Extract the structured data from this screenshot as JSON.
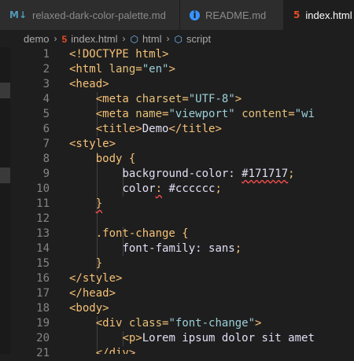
{
  "tabs": [
    {
      "label": "relaxed-dark-color-palette.md",
      "icon": "markdown-icon",
      "icon_text": "M↓",
      "active": false
    },
    {
      "label": "README.md",
      "icon": "info-icon",
      "icon_text": "i",
      "active": false
    },
    {
      "label": "index.html",
      "icon": "html5-icon",
      "icon_text": "5",
      "active": true
    }
  ],
  "breadcrumb": {
    "items": [
      {
        "label": "demo",
        "icon": ""
      },
      {
        "label": "index.html",
        "icon": "html5-icon",
        "icon_text": "5"
      },
      {
        "label": "html",
        "icon": "cube-icon",
        "icon_text": "⬡"
      },
      {
        "label": "script",
        "icon": "cube-icon",
        "icon_text": "⬡"
      }
    ],
    "separator": "›"
  },
  "editor": {
    "line_numbers": [
      "1",
      "2",
      "3",
      "4",
      "5",
      "6",
      "7",
      "8",
      "9",
      "10",
      "11",
      "12",
      "13",
      "14",
      "15",
      "16",
      "17",
      "18",
      "19",
      "20",
      "21"
    ],
    "lines": [
      [
        [
          "t-tag",
          "<!DOCTYPE html>"
        ]
      ],
      [
        [
          "t-tag",
          "<html "
        ],
        [
          "t-attr",
          "lang"
        ],
        [
          "t-tag",
          "="
        ],
        [
          "t-str",
          "\"en\""
        ],
        [
          "t-tag",
          ">"
        ]
      ],
      [
        [
          "t-tag",
          "<head>"
        ]
      ],
      [
        [
          "t-txt",
          "    "
        ],
        [
          "t-tag",
          "<meta "
        ],
        [
          "t-attr",
          "charset"
        ],
        [
          "t-tag",
          "="
        ],
        [
          "t-str",
          "\"UTF-8\""
        ],
        [
          "t-tag",
          ">"
        ]
      ],
      [
        [
          "t-txt",
          "    "
        ],
        [
          "t-tag",
          "<meta "
        ],
        [
          "t-attr",
          "name"
        ],
        [
          "t-tag",
          "="
        ],
        [
          "t-str",
          "\"viewport\""
        ],
        [
          "t-txt",
          " "
        ],
        [
          "t-attr",
          "content"
        ],
        [
          "t-tag",
          "="
        ],
        [
          "t-str",
          "\"wi"
        ]
      ],
      [
        [
          "t-txt",
          "    "
        ],
        [
          "t-tag",
          "<title>"
        ],
        [
          "t-txt",
          "Demo"
        ],
        [
          "t-tag",
          "</title>"
        ]
      ],
      [
        [
          "t-tag",
          "<style>"
        ]
      ],
      [
        [
          "t-txt",
          "    "
        ],
        [
          "t-sel",
          "body "
        ],
        [
          "t-punc",
          "{"
        ]
      ],
      [
        [
          "t-txt",
          "        "
        ],
        [
          "t-prop",
          "background-color: "
        ],
        [
          "t-num squiggle",
          "#171717"
        ],
        [
          "t-punc",
          ";"
        ]
      ],
      [
        [
          "t-txt",
          "        "
        ],
        [
          "t-prop",
          "color"
        ],
        [
          "t-punc squiggle",
          ":"
        ],
        [
          "t-val",
          " #cccccc"
        ],
        [
          "t-punc",
          ";"
        ]
      ],
      [
        [
          "t-txt",
          "    "
        ],
        [
          "t-punc squiggle",
          "}"
        ]
      ],
      [
        [
          "t-txt",
          ""
        ]
      ],
      [
        [
          "t-txt",
          "    "
        ],
        [
          "t-sel",
          ".font-change "
        ],
        [
          "t-punc",
          "{"
        ]
      ],
      [
        [
          "t-txt",
          "        "
        ],
        [
          "t-prop",
          "font-family: "
        ],
        [
          "t-val",
          "sans"
        ],
        [
          "t-punc",
          ";"
        ]
      ],
      [
        [
          "t-txt",
          "    "
        ],
        [
          "t-punc",
          "}"
        ]
      ],
      [
        [
          "t-tag",
          "</style>"
        ]
      ],
      [
        [
          "t-tag",
          "</head>"
        ]
      ],
      [
        [
          "t-tag",
          "<body>"
        ]
      ],
      [
        [
          "t-txt",
          "    "
        ],
        [
          "t-tag",
          "<div "
        ],
        [
          "t-attr",
          "class"
        ],
        [
          "t-tag",
          "="
        ],
        [
          "t-str",
          "\"font-change\""
        ],
        [
          "t-tag",
          ">"
        ]
      ],
      [
        [
          "t-txt",
          "        "
        ],
        [
          "t-tag",
          "<p>"
        ],
        [
          "t-txt",
          "Lorem ipsum dolor sit amet"
        ]
      ],
      [
        [
          "t-txt",
          "    "
        ],
        [
          "t-tag",
          "</div>"
        ]
      ]
    ]
  }
}
